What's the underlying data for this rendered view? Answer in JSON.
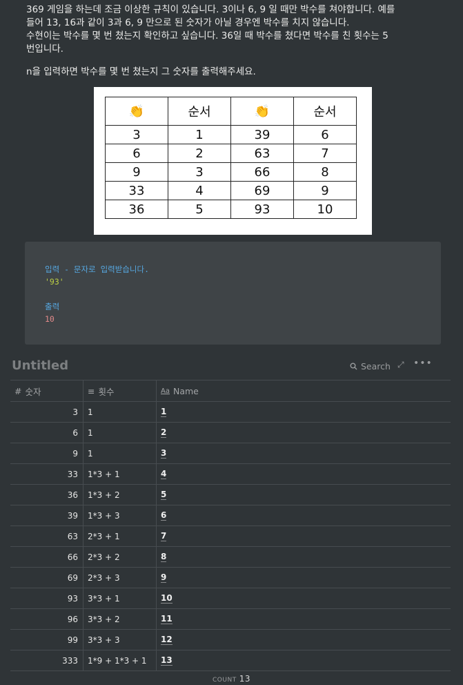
{
  "problem": {
    "line1": "369 게임을 하는데 조금 이상한 규칙이 있습니다. 3이나 6, 9 일 때만 박수를 쳐야합니다. 예를",
    "line2": "들어 13, 16과 같이 3과 6, 9 만으로 된 숫자가 아닐 경우엔 박수를 치지 않습니다.",
    "line3": "수현이는 박수를 몇 번 쳤는지 확인하고 싶습니다. 36일 때 박수를 쳤다면 박수를 친 횟수는 5",
    "line4": "번입니다.",
    "line5": "n을 입력하면 박수를 몇 번 쳤는지 그 숫자를 출력해주세요."
  },
  "image_table": {
    "headers": [
      "👏",
      "순서",
      "👏",
      "순서"
    ],
    "rows": [
      [
        "3",
        "1",
        "39",
        "6"
      ],
      [
        "6",
        "2",
        "63",
        "7"
      ],
      [
        "9",
        "3",
        "66",
        "8"
      ],
      [
        "33",
        "4",
        "69",
        "9"
      ],
      [
        "36",
        "5",
        "93",
        "10"
      ]
    ]
  },
  "code": {
    "input_label": "입력 - 문자로 입력받습니다.",
    "input_value": "'93'",
    "output_label": "출력",
    "output_value": "10"
  },
  "database": {
    "title": "Untitled",
    "search_label": "Search",
    "columns": {
      "number": "숫자",
      "count": "횟수",
      "name": "Name"
    },
    "rows": [
      {
        "num": "3",
        "count": "1",
        "name": "1"
      },
      {
        "num": "6",
        "count": "1",
        "name": "2"
      },
      {
        "num": "9",
        "count": "1",
        "name": "3"
      },
      {
        "num": "33",
        "count": "1*3 + 1",
        "name": "4"
      },
      {
        "num": "36",
        "count": "1*3 + 2",
        "name": "5"
      },
      {
        "num": "39",
        "count": "1*3 + 3",
        "name": "6"
      },
      {
        "num": "63",
        "count": "2*3 + 1",
        "name": "7"
      },
      {
        "num": "66",
        "count": "2*3 + 2",
        "name": "8"
      },
      {
        "num": "69",
        "count": "2*3 + 3",
        "name": "9"
      },
      {
        "num": "93",
        "count": "3*3 + 1",
        "name": "10"
      },
      {
        "num": "96",
        "count": "3*3 + 2",
        "name": "11"
      },
      {
        "num": "99",
        "count": "3*3 + 3",
        "name": "12"
      },
      {
        "num": "333",
        "count": "1*9 + 1*3 + 1",
        "name": "13"
      }
    ],
    "count_label": "COUNT",
    "count_value": "13"
  }
}
